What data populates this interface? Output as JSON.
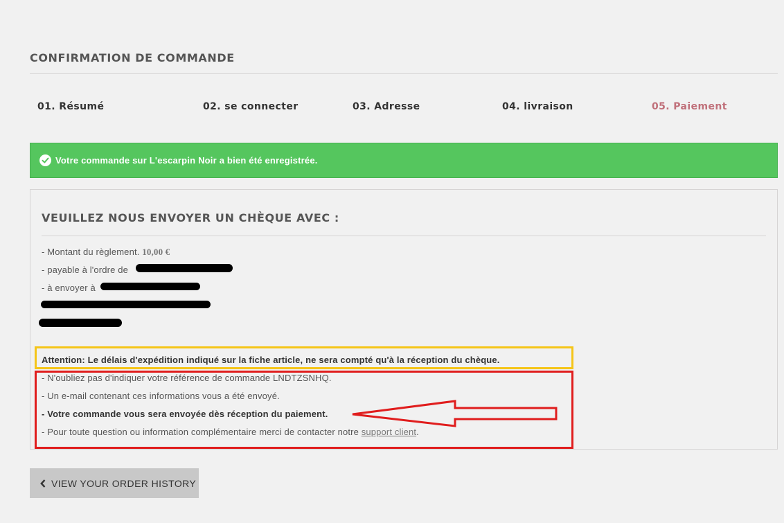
{
  "page_title": "CONFIRMATION DE COMMANDE",
  "steps": [
    {
      "label": "01. Résumé"
    },
    {
      "label": "02. se connecter"
    },
    {
      "label": "03. Adresse"
    },
    {
      "label": "04. livraison"
    },
    {
      "label": "05. Paiement",
      "active": true
    }
  ],
  "alert": {
    "icon": "check-circle-icon",
    "text": "Votre commande sur L'escarpin Noir a bien été enregistrée.",
    "color": "#55c65e"
  },
  "payment_box": {
    "title": "VEUILLEZ NOUS ENVOYER UN CHÈQUE AVEC :",
    "amount_label": "- Montant du règlement.",
    "amount_value": "10,00 €",
    "payable_label": "- payable à l'ordre de",
    "send_label": "- à envoyer à",
    "attention": "Attention: Le délais d'expédition indiqué sur la fiche article, ne sera compté qu'à la réception du chèque.",
    "reference_line": "- N'oubliez pas d'indiquer votre référence de commande LNDTZSNHQ.",
    "email_line": "- Un e-mail contenant ces informations vous a été envoyé.",
    "shipping_line": "- Votre commande vous sera envoyée dès réception du paiement.",
    "contact_prefix": "- Pour toute question ou information complémentaire merci de contacter notre",
    "contact_link": "support client",
    "contact_suffix": "."
  },
  "annotations": {
    "yellow_box_color": "#f5c518",
    "red_box_color": "#e01d1d"
  },
  "history_button": {
    "icon": "chevron-left-icon",
    "label": "VIEW YOUR ORDER HISTORY"
  }
}
